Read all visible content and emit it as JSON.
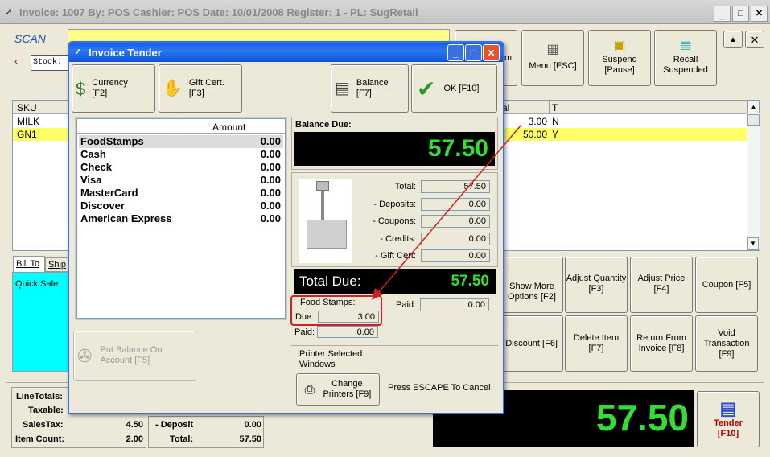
{
  "main_title": "Invoice: 1007  By: POS  Cashier: POS  Date: 10/01/2008  Register: 1 - PL: SugRetail",
  "scan_label": "SCAN",
  "stock_label": "Stock:",
  "top_buttons": {
    "menu": "Menu [ESC]",
    "suspend": "Suspend\n[Pause]",
    "recall": "Recall\nSuspended",
    "partial": "m"
  },
  "grid": {
    "col_sku": "SKU",
    "col_total": "al",
    "col_t": "T",
    "rows": [
      {
        "sku": "MILK",
        "total": "3.00",
        "t": "N"
      },
      {
        "sku": "GN1",
        "total": "50.00",
        "t": "Y"
      }
    ]
  },
  "tabs": {
    "bill_to": "Bill To",
    "ship": "Ship"
  },
  "customer": "Quick Sale",
  "right_buttons": {
    "show_more": "Show More\nOptions [F2]",
    "adjust_qty": "Adjust Quantity\n[F3]",
    "adjust_price": "Adjust Price [F4]",
    "coupon": "Coupon [F5]",
    "discount": "Discount [F6]",
    "delete_item": "Delete Item [F7]",
    "return_from": "Return From\nInvoice [F8]",
    "void": "Void\nTransaction [F9]"
  },
  "totals": {
    "line_totals": "LineTotals:",
    "taxable": "Taxable:",
    "sales_tax_label": "SalesTax:",
    "sales_tax": "4.50",
    "item_count_label": "Item Count:",
    "item_count": "2.00",
    "deposit_label": "- Deposit",
    "deposit": "0.00",
    "total_label": "Total:",
    "total": "57.50"
  },
  "big_total": "57.50",
  "tender_button": "Tender\n[F10]",
  "dialog": {
    "title": "Invoice Tender",
    "currency": "Currency\n[F2]",
    "gift_cert": "Gift Cert.\n[F3]",
    "balance": "Balance\n[F7]",
    "ok": "OK [F10]",
    "amount_header": "Amount",
    "tenders": [
      {
        "name": "FoodStamps",
        "amount": "0.00"
      },
      {
        "name": "Cash",
        "amount": "0.00"
      },
      {
        "name": "Check",
        "amount": "0.00"
      },
      {
        "name": "Visa",
        "amount": "0.00"
      },
      {
        "name": "MasterCard",
        "amount": "0.00"
      },
      {
        "name": "Discover",
        "amount": "0.00"
      },
      {
        "name": "American Express",
        "amount": "0.00"
      }
    ],
    "put_balance": "Put Balance On\nAccount [F5]",
    "balance_due_label": "Balance Due:",
    "balance_due": "57.50",
    "summary": [
      {
        "label": "Total:",
        "value": "57.50"
      },
      {
        "label": "- Deposits:",
        "value": "0.00"
      },
      {
        "label": "- Coupons:",
        "value": "0.00"
      },
      {
        "label": "- Credits:",
        "value": "0.00"
      },
      {
        "label": "- Gift Cert:",
        "value": "0.00"
      }
    ],
    "total_due_label": "Total Due:",
    "total_due": "57.50",
    "food_stamps_label": "Food Stamps:",
    "due_label": "Due:",
    "fs_due": "3.00",
    "paid_label": "Paid:",
    "fs_paid": "0.00",
    "paid": "0.00",
    "printer_selected_label": "Printer Selected:",
    "printer_name": "Windows",
    "change_printers": "Change\nPrinters [F9]",
    "escape_hint": "Press ESCAPE To Cancel"
  }
}
